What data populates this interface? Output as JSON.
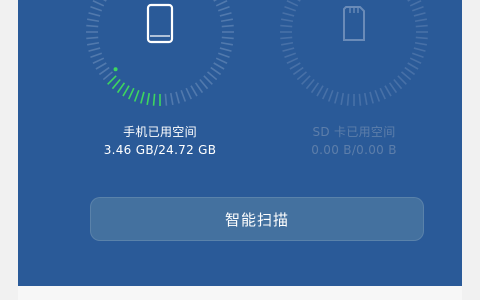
{
  "storage": {
    "phone": {
      "label": "手机已用空间",
      "value": "3.46 GB/24.72 GB",
      "used_fraction": 0.14,
      "icon": "phone-icon"
    },
    "sd": {
      "label": "SD 卡已用空间",
      "value": "0.00 B/0.00 B",
      "used_fraction": 0,
      "icon": "sd-card-icon"
    }
  },
  "actions": {
    "scan_label": "智能扫描"
  },
  "colors": {
    "panel_bg": "#2a5a98",
    "accent_green": "#3dd65f",
    "tick_idle": "#5f84b4",
    "button_bg": "#44719f",
    "dim_text": "#5d7eaa"
  }
}
